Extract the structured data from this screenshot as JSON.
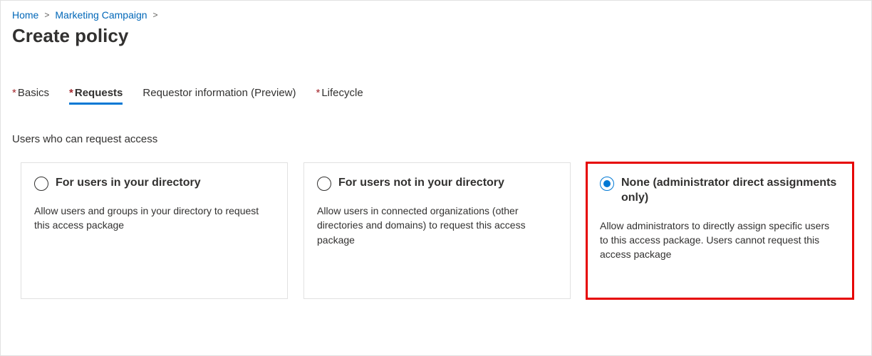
{
  "breadcrumb": {
    "items": [
      {
        "label": "Home"
      },
      {
        "label": "Marketing Campaign"
      }
    ]
  },
  "page_title": "Create policy",
  "tabs": {
    "basics": {
      "label": "Basics",
      "required": true
    },
    "requests": {
      "label": "Requests",
      "required": true
    },
    "requestor_info": {
      "label": "Requestor information (Preview)",
      "required": false
    },
    "lifecycle": {
      "label": "Lifecycle",
      "required": true
    }
  },
  "section": {
    "label": "Users who can request access"
  },
  "options": {
    "in_directory": {
      "title": "For users in your directory",
      "desc": "Allow users and groups in your directory to request this access package"
    },
    "not_in_directory": {
      "title": "For users not in your directory",
      "desc": "Allow users in connected organizations (other directories and domains) to request this access package"
    },
    "none": {
      "title": "None (administrator direct assignments only)",
      "desc": "Allow administrators to directly assign specific users to this access package. Users cannot request this access package"
    }
  }
}
